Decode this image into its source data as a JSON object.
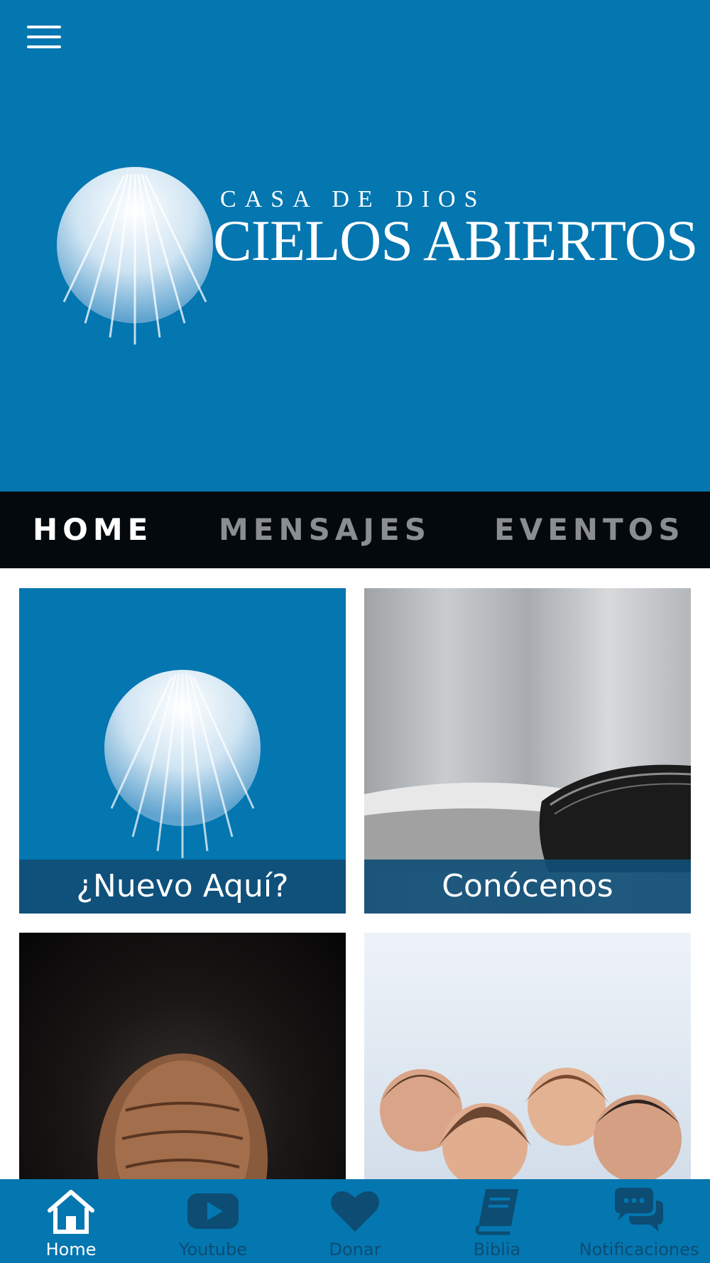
{
  "header": {
    "logo": {
      "subtitle": "CASA DE DIOS",
      "title": "CIELOS ABIERTOS"
    }
  },
  "tabs": [
    {
      "label": "HOME",
      "active": true
    },
    {
      "label": "MENSAJES",
      "active": false
    },
    {
      "label": "EVENTOS",
      "active": false
    }
  ],
  "tiles": [
    {
      "label": "¿Nuevo Aquí?",
      "image": "logo-orb"
    },
    {
      "label": "Conócenos",
      "image": "open-bible"
    },
    {
      "label": "",
      "image": "praying-hands"
    },
    {
      "label": "",
      "image": "family-photo"
    }
  ],
  "bottom_nav": [
    {
      "label": "Home",
      "icon": "home-icon",
      "active": true
    },
    {
      "label": "Youtube",
      "icon": "youtube-icon",
      "active": false
    },
    {
      "label": "Donar",
      "icon": "heart-icon",
      "active": false
    },
    {
      "label": "Biblia",
      "icon": "book-icon",
      "active": false
    },
    {
      "label": "Notificaciones",
      "icon": "chat-icon",
      "active": false
    }
  ],
  "colors": {
    "brand_blue": "#0476b0",
    "tab_bar": "#03090d",
    "inactive_tab": "#8b8e90",
    "inactive_nav": "#0d4d73"
  }
}
